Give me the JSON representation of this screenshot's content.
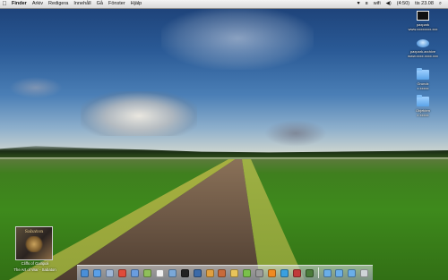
{
  "menubar": {
    "apple": "",
    "items": [
      "Finder",
      "Arkiv",
      "Redigera",
      "Innehåll",
      "Gå",
      "Fönster",
      "Hjälp"
    ],
    "status": {
      "heart": "♥",
      "bluetooth": "ʙ",
      "wifi": "wifi",
      "volume": "◀)",
      "battery": "(4:50)",
      "clock": "tis 23.08",
      "spotlight": "⌕"
    }
  },
  "desktop_icons": [
    {
      "label": "paxpark\nwww.xxxxxxxx.xxx",
      "icon": "monitor-icon"
    },
    {
      "label": "paxpark.archive\nwww.xxxx.xxxx.xxx",
      "icon": "disk-icon"
    },
    {
      "label": "Grundx\nx xxxxx",
      "icon": "folder-icon"
    },
    {
      "label": "Objekten\nx xxxxx",
      "icon": "folder-icon"
    }
  ],
  "now_playing": {
    "band": "Sabaton",
    "track": "Cliffs of Gallipoli",
    "album": "The Art of War - Sabaton"
  },
  "dock": {
    "icons": [
      {
        "name": "finder-icon",
        "color": "#4a8fd8"
      },
      {
        "name": "safari-icon",
        "color": "#5aa0e8"
      },
      {
        "name": "mail-icon",
        "color": "#9fb6d6"
      },
      {
        "name": "ical-icon",
        "color": "#e04b3a"
      },
      {
        "name": "itunes-icon",
        "color": "#6a9de0"
      },
      {
        "name": "iphoto-icon",
        "color": "#8fbf5a"
      },
      {
        "name": "textedit-icon",
        "color": "#f0f0f0"
      },
      {
        "name": "preview-icon",
        "color": "#7aa8d8"
      },
      {
        "name": "terminal-icon",
        "color": "#222222"
      },
      {
        "name": "photoshop-icon",
        "color": "#3b6aa8"
      },
      {
        "name": "app-store-icon",
        "color": "#e0a040"
      },
      {
        "name": "dictionary-icon",
        "color": "#c86a3a"
      },
      {
        "name": "chess-icon",
        "color": "#e8c45a"
      },
      {
        "name": "adium-icon",
        "color": "#7ac04a"
      },
      {
        "name": "system-preferences-icon",
        "color": "#9a9a9a"
      },
      {
        "name": "vlc-icon",
        "color": "#f08a20"
      },
      {
        "name": "skype-icon",
        "color": "#3aa0e0"
      },
      {
        "name": "transmission-icon",
        "color": "#c03a3a"
      },
      {
        "name": "activity-monitor-icon",
        "color": "#4a7a3a"
      },
      {
        "name": "applications-folder-icon",
        "color": "#6aaee8"
      },
      {
        "name": "documents-folder-icon",
        "color": "#6aaee8"
      },
      {
        "name": "downloads-folder-icon",
        "color": "#6aaee8"
      },
      {
        "name": "trash-icon",
        "color": "#cfd4d8"
      }
    ]
  }
}
